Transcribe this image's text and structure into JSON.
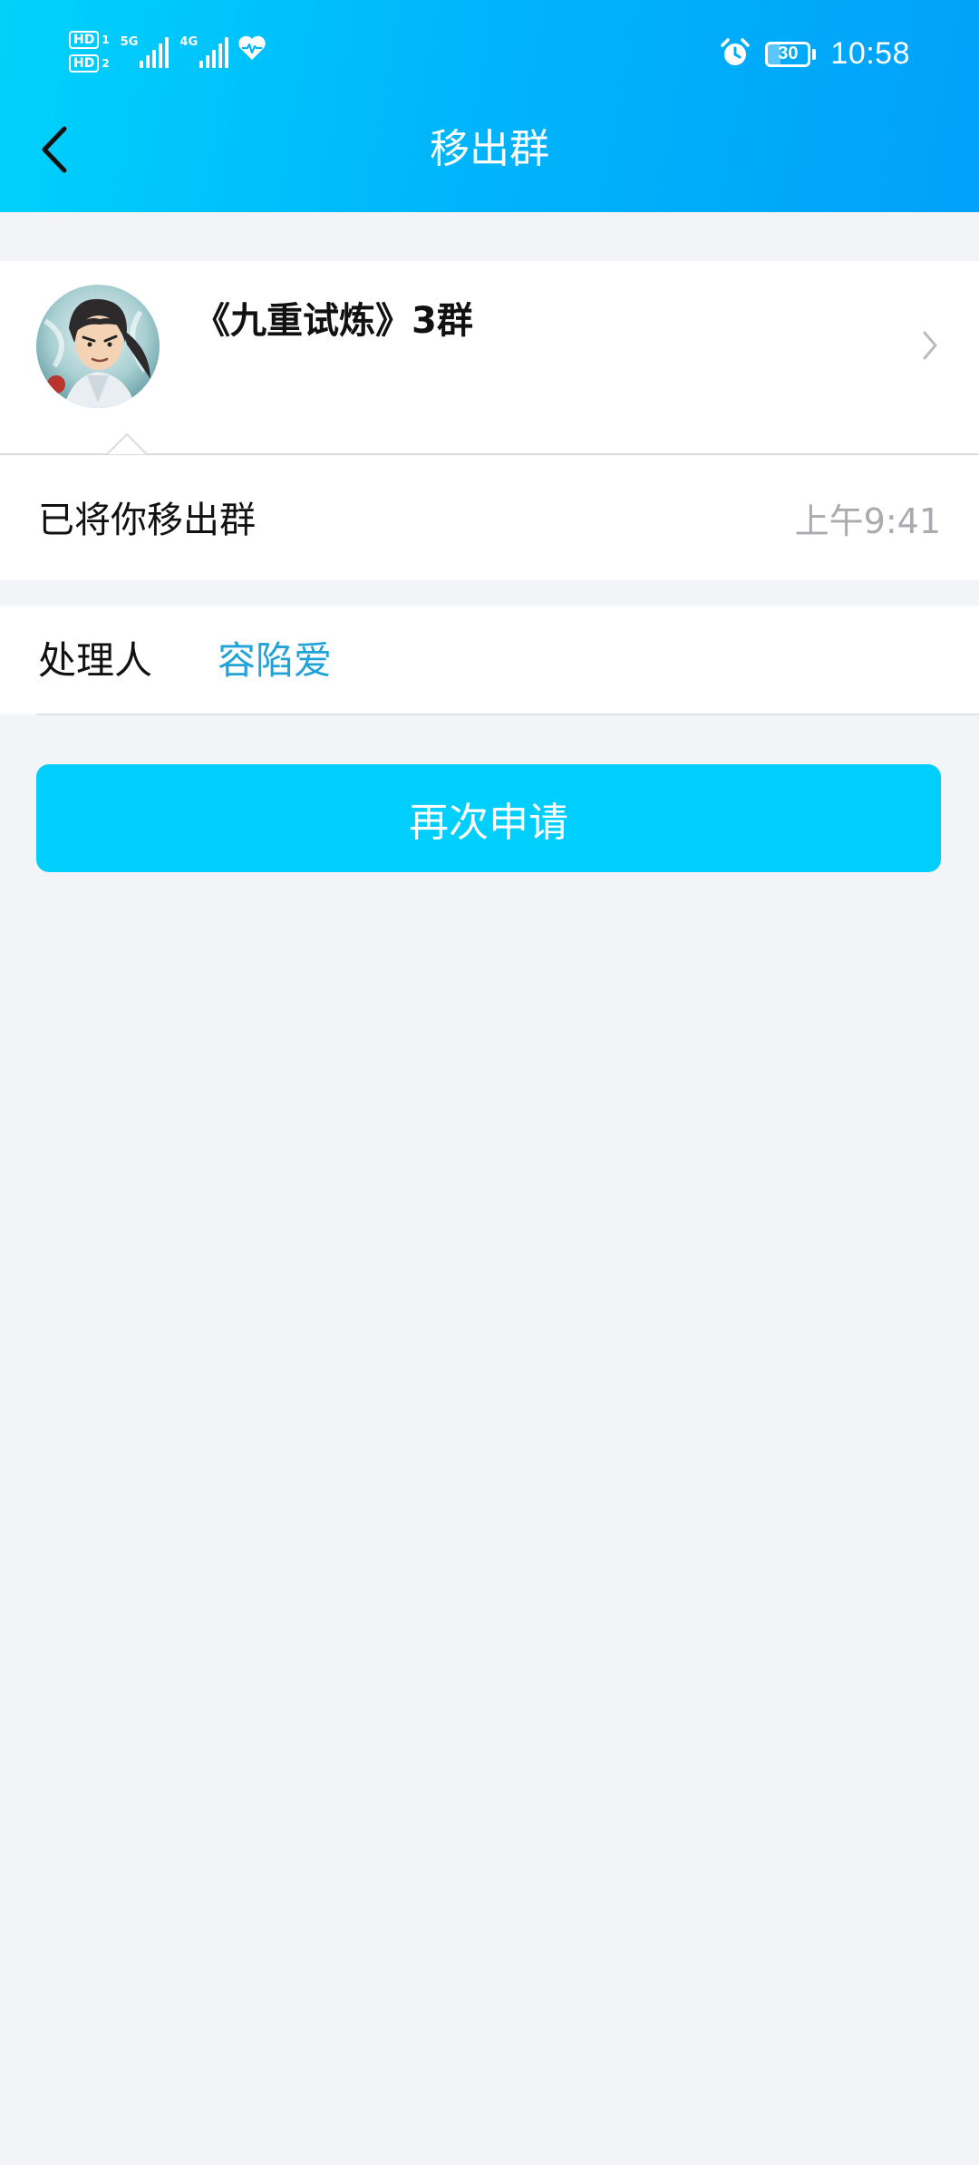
{
  "status_bar": {
    "sim1_badge": "HD",
    "sim1_index": "1",
    "sim2_badge": "HD",
    "sim2_index": "2",
    "network1": "5G",
    "network2": "4G",
    "battery_level": "30",
    "clock": "10:58",
    "icons": [
      "signal-bars-icon",
      "heart-health-icon",
      "alarm-clock-icon",
      "battery-icon"
    ]
  },
  "header": {
    "title": "移出群",
    "back_icon": "chevron-left-icon"
  },
  "group": {
    "name": "《九重试炼》3群",
    "avatar_icon": "group-avatar",
    "chevron_icon": "chevron-right-icon"
  },
  "message": {
    "text": "已将你移出群",
    "time": "上午9:41"
  },
  "handler": {
    "label": "处理人",
    "name": "容陷爱"
  },
  "actions": {
    "reapply_label": "再次申请"
  },
  "colors": {
    "header_gradient_start": "#00d2fb",
    "header_gradient_end": "#01a1f9",
    "accent_button": "#00cefd",
    "link_text": "#20a3d8",
    "page_background": "#f3f4f8",
    "muted_text": "#a9abb0"
  }
}
